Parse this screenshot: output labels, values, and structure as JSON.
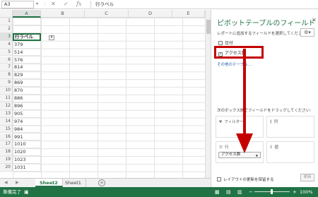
{
  "formula_bar": {
    "name_box": "A3",
    "fx_label": "fx",
    "formula_value": "行ラベル"
  },
  "grid": {
    "columns": [
      "A",
      "B",
      "C",
      "D",
      "E"
    ],
    "rows": [
      "1",
      "2",
      "3",
      "4",
      "5",
      "6",
      "7",
      "8",
      "9",
      "10",
      "11",
      "12",
      "13",
      "14",
      "15",
      "16",
      "17",
      "18",
      "19",
      "20"
    ],
    "column_a": [
      "",
      "",
      "行ラベル",
      "379",
      "514",
      "576",
      "814",
      "829",
      "869",
      "870",
      "886",
      "896",
      "905",
      "974",
      "984",
      "991",
      "1010",
      "1020",
      "1023",
      "1031"
    ]
  },
  "sheets": {
    "tabs": [
      "Sheet2",
      "Sheet1"
    ],
    "active": "Sheet2"
  },
  "status_bar": {
    "status": "準備完了",
    "zoom": "100%"
  },
  "pivot_pane": {
    "title": "ピボットテーブルのフィールド",
    "subtitle": "レポートに追加するフィールドを選択してください:",
    "fields": [
      {
        "label": "日付",
        "checked": false
      },
      {
        "label": "アクセス数",
        "checked": true
      }
    ],
    "more_tables": "その他のテーブル...",
    "areas_title": "次のボックス間でフィールドをドラッグしてください:",
    "areas": {
      "filter": "フィルター",
      "columns": "列",
      "rows": "行",
      "values": "値"
    },
    "rows_chip": "アクセス数",
    "defer_label": "レイアウトの更新を保留する",
    "update_button": "更新"
  },
  "colors": {
    "excel_green": "#217346",
    "highlight_red": "#c40000"
  }
}
